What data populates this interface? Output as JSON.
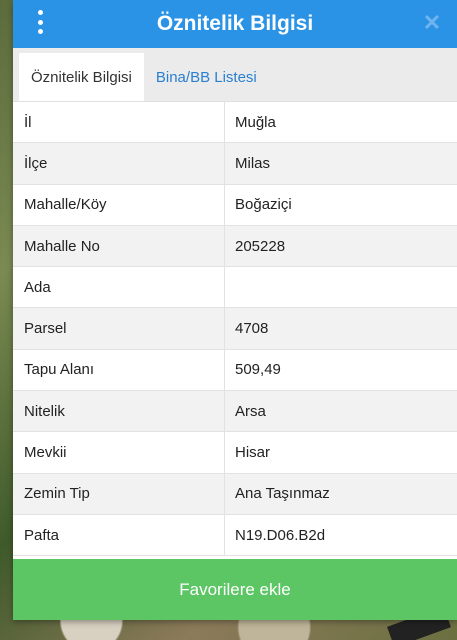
{
  "header": {
    "title": "Öznitelik Bilgisi"
  },
  "tabs": [
    {
      "label": "Öznitelik Bilgisi",
      "active": true
    },
    {
      "label": "Bina/BB Listesi",
      "active": false
    }
  ],
  "rows": [
    {
      "key": "İl",
      "value": "Muğla"
    },
    {
      "key": "İlçe",
      "value": "Milas"
    },
    {
      "key": "Mahalle/Köy",
      "value": "Boğaziçi"
    },
    {
      "key": "Mahalle No",
      "value": "205228"
    },
    {
      "key": "Ada",
      "value": ""
    },
    {
      "key": "Parsel",
      "value": "4708"
    },
    {
      "key": "Tapu Alanı",
      "value": "509,49"
    },
    {
      "key": "Nitelik",
      "value": "Arsa"
    },
    {
      "key": "Mevkii",
      "value": "Hisar"
    },
    {
      "key": "Zemin Tip",
      "value": "Ana Taşınmaz"
    },
    {
      "key": "Pafta",
      "value": "N19.D06.B2d"
    }
  ],
  "footer": {
    "favorite_label": "Favorilere ekle"
  },
  "colors": {
    "header": "#2b93e6",
    "tab_inactive_text": "#2a7fd1",
    "favorite_button": "#5cc664"
  }
}
